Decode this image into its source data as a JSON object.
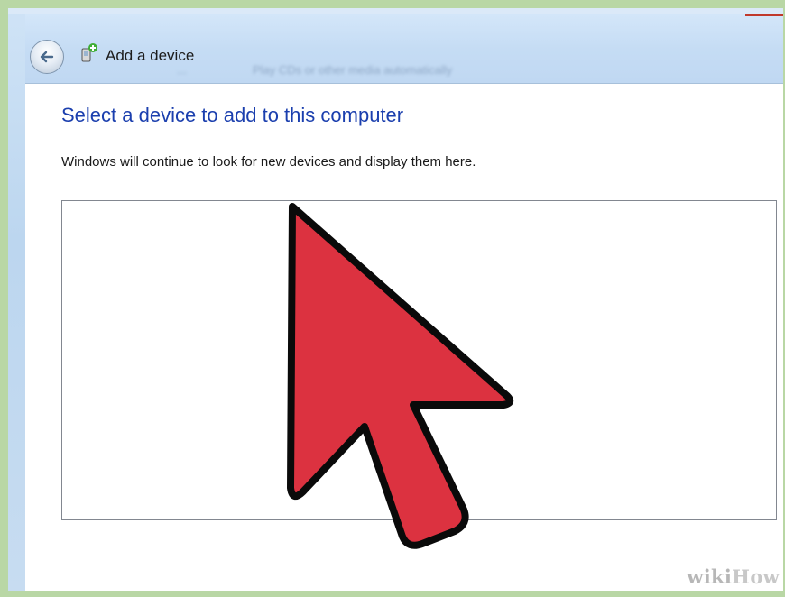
{
  "window": {
    "title": "Add a device",
    "background_text_1": "...",
    "background_text_2": "Play CDs or other media automatically"
  },
  "navigation": {
    "back_icon": "back-arrow-icon",
    "device_icon": "add-device-icon"
  },
  "main": {
    "heading": "Select a device to add to this computer",
    "description": "Windows will continue to look for new devices and display them here."
  },
  "overlay": {
    "cursor_icon": "mouse-pointer-icon",
    "cursor_color": "#dc3240",
    "watermark_wiki": "wiki",
    "watermark_how": "How"
  },
  "colors": {
    "frame": "#b9d7a5",
    "titlebar": "#c5dcf4",
    "heading": "#1b3fae"
  }
}
